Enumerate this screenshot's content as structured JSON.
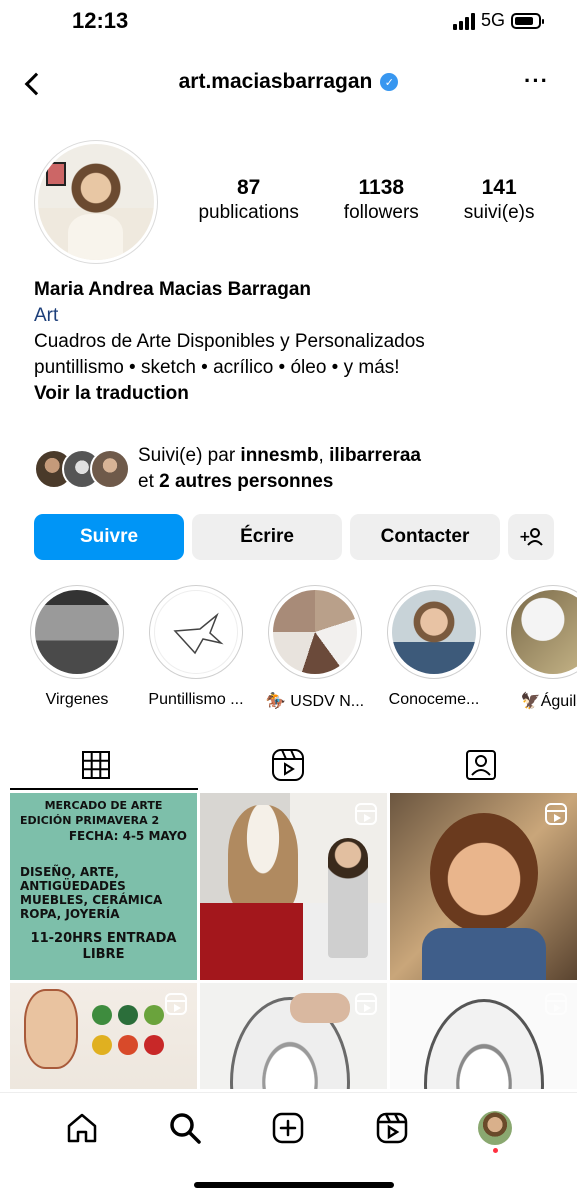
{
  "status_bar": {
    "time": "12:13",
    "network": "5G"
  },
  "header": {
    "username": "art.maciasbarragan",
    "verified_icon": "check"
  },
  "profile": {
    "stats": [
      {
        "value": "87",
        "label": "publications"
      },
      {
        "value": "1138",
        "label": "followers"
      },
      {
        "value": "141",
        "label": "suivi(e)s"
      }
    ],
    "name": "Maria Andrea Macias Barragan",
    "category": "Art",
    "bio_lines": [
      "Cuadros de Arte Disponibles y Personalizados",
      "puntillismo • sketch • acrílico • óleo • y más!"
    ],
    "translate": "Voir la traduction"
  },
  "followed_by": {
    "prefix": "Suivi(e) par ",
    "user1": "innesmb",
    "separator": ", ",
    "user2": "ilibarreraa",
    "and": "et ",
    "others": "2 autres personnes"
  },
  "actions": {
    "follow": "Suivre",
    "message": "Écrire",
    "contact": "Contacter",
    "add_user_icon": "+person-icon"
  },
  "highlights": [
    {
      "label": "Virgenes"
    },
    {
      "label": "Puntillismo ..."
    },
    {
      "label": "🏇 USDV N..."
    },
    {
      "label": "Conoceme..."
    },
    {
      "label": "🦅Águila"
    }
  ],
  "grid": {
    "poster": {
      "line1": "MERCADO DE ARTE",
      "line2": "EDICIÓN PRIMAVERA 2",
      "line3": "FECHA: 4-5 MAYO",
      "line4": "DISEÑO, ARTE, ANTIGÜEDADES MUEBLES, CERÁMICA ROPA, JOYERÍA",
      "line5": "11-20HRS ENTRADA LIBRE"
    }
  },
  "colors": {
    "accent": "#0095f6",
    "verified": "#3897f0",
    "notification": "#ff3040"
  }
}
